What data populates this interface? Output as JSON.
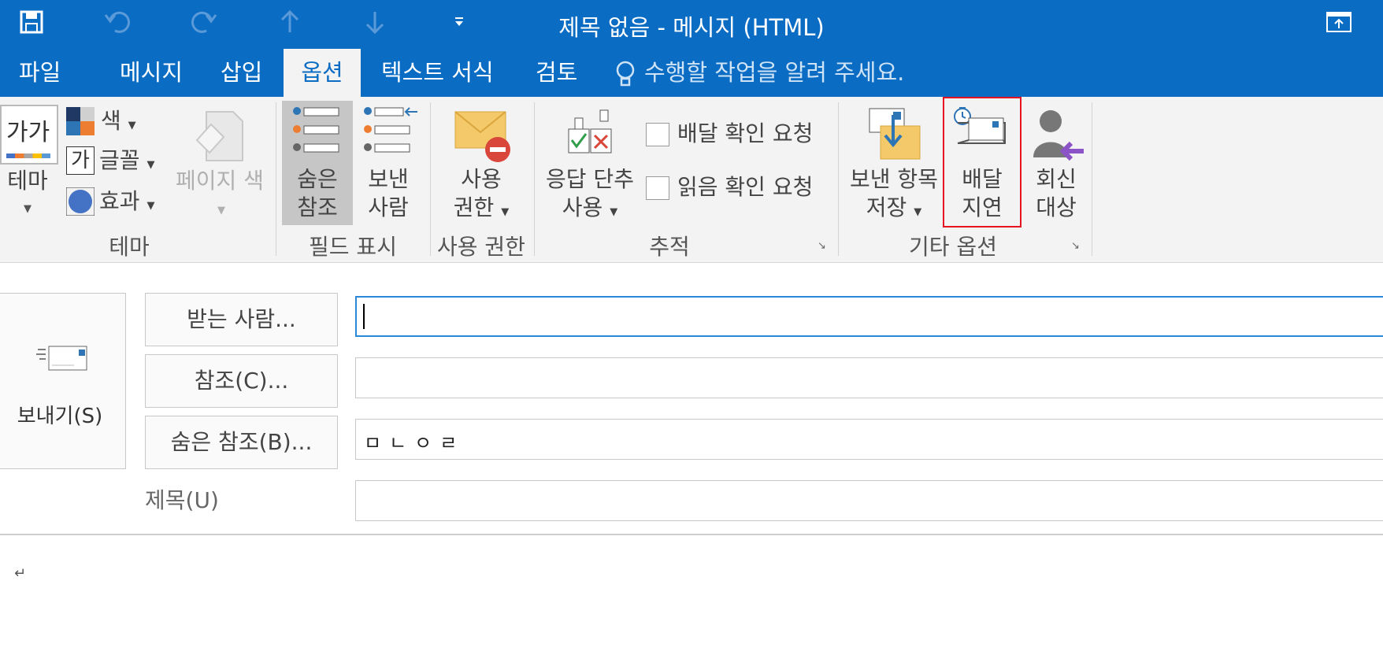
{
  "window": {
    "title": "제목 없음 - 메시지 (HTML)"
  },
  "qat": {
    "icons": [
      "save-icon",
      "undo-icon",
      "redo-icon",
      "up-arrow-icon",
      "down-arrow-icon",
      "customize-dropdown-icon"
    ]
  },
  "tabs": [
    {
      "label": "파일",
      "active": false
    },
    {
      "label": "메시지",
      "active": false
    },
    {
      "label": "삽입",
      "active": false
    },
    {
      "label": "옵션",
      "active": true
    },
    {
      "label": "텍스트 서식",
      "active": false
    },
    {
      "label": "검토",
      "active": false
    }
  ],
  "tellme": {
    "text": "수행할 작업을 알려 주세요."
  },
  "ribbon": {
    "theme_group": {
      "label": "테마",
      "theme_button": {
        "label": "테마",
        "icon_text": "가가"
      },
      "color_label": "색",
      "font_label": "글꼴",
      "font_icon_text": "가",
      "effects_label": "효과",
      "page_color_label": "페이지 색"
    },
    "fields_group": {
      "label": "필드 표시",
      "bcc": {
        "line1": "숨은",
        "line2": "참조"
      },
      "from": {
        "line1": "보낸",
        "line2": "사람"
      }
    },
    "permission_group": {
      "label": "사용 권한",
      "permission": {
        "line1": "사용",
        "line2": "권한"
      }
    },
    "tracking_group": {
      "label": "추적",
      "voting": {
        "line1": "응답 단추",
        "line2": "사용"
      },
      "delivery_receipt": "배달 확인 요청",
      "read_receipt": "읽음 확인 요청"
    },
    "more_options_group": {
      "label": "기타 옵션",
      "save_sent": {
        "line1": "보낸 항목",
        "line2": "저장"
      },
      "delay_delivery": {
        "line1": "배달",
        "line2": "지연"
      },
      "direct_replies": {
        "line1": "회신",
        "line2": "대상"
      }
    }
  },
  "compose": {
    "send_label": "보내기(S)",
    "to_label": "받는 사람...",
    "cc_label": "참조(C)...",
    "bcc_label": "숨은 참조(B)...",
    "subject_label": "제목(U)",
    "to_value": "",
    "cc_value": "",
    "bcc_value": "ㅁㄴㅇㄹ",
    "subject_value": "",
    "body_mark": "↵"
  },
  "colors": {
    "accent": "#0b6cc4",
    "highlight_box": "#e81123"
  }
}
